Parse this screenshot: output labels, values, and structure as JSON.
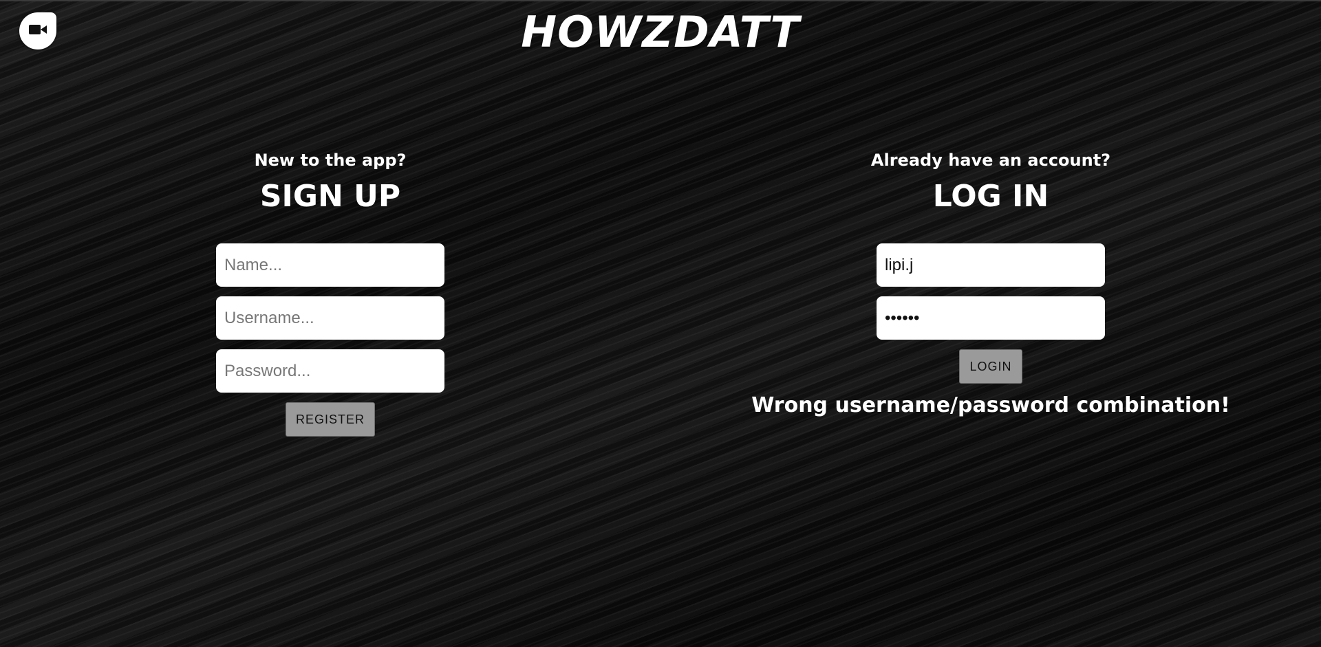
{
  "header": {
    "title": "HOWZDATT",
    "logo_icon": "video-camera-icon"
  },
  "signup": {
    "prompt": "New to the app?",
    "heading": "SIGN UP",
    "name_placeholder": "Name...",
    "username_placeholder": "Username...",
    "password_placeholder": "Password...",
    "register_label": "REGISTER"
  },
  "login": {
    "prompt": "Already have an account?",
    "heading": "LOG IN",
    "username_value": "lipi.j",
    "password_value": "••••••",
    "login_label": "LOGIN",
    "error": "Wrong username/password combination!"
  },
  "colors": {
    "background": "#111111",
    "text": "#ffffff",
    "button": "#9a9a9a"
  }
}
